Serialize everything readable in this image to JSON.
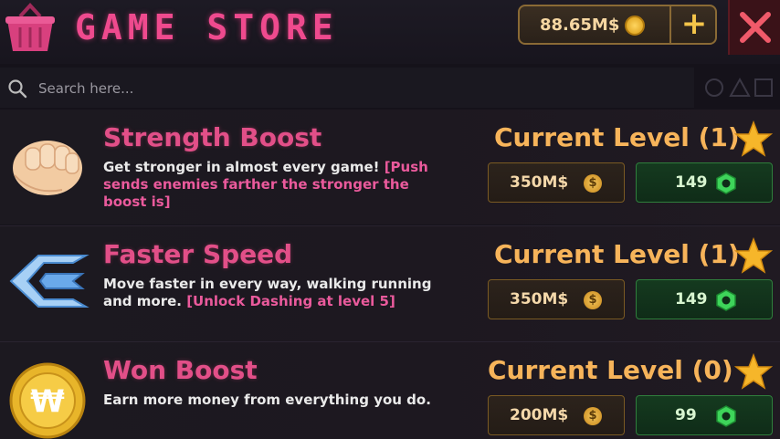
{
  "header": {
    "title": "GAME STORE",
    "currency_amount": "88.65M$",
    "icons": [
      "basket-icon",
      "coin-icon",
      "plus-icon",
      "close-icon"
    ]
  },
  "search": {
    "placeholder": "Search here...",
    "icons": [
      "search-icon",
      "circle-triangle-square-icon"
    ]
  },
  "items": [
    {
      "name": "Strength Boost",
      "desc_main": "Get stronger in almost every game! ",
      "desc_highlight": "[Push sends enemies farther the stronger the boost is]",
      "level_text": "Current Level (1)",
      "price": "350M$",
      "gems": "149",
      "icon": "fist-icon"
    },
    {
      "name": "Faster Speed",
      "desc_main": "Move faster in every way, walking running and more. ",
      "desc_highlight": "[Unlock Dashing at level 5]",
      "level_text": "Current Level (1)",
      "price": "350M$",
      "gems": "149",
      "icon": "speed-arrow-icon"
    },
    {
      "name": "Won Boost",
      "desc_main": "Earn more money from everything you do.",
      "desc_highlight": "",
      "level_text": "Current Level (0)",
      "price": "200M$",
      "gems": "99",
      "icon": "won-coin-icon"
    }
  ],
  "colors": {
    "title": "#ef4a8e",
    "item_name": "#e24f88",
    "level": "#f7b45a",
    "gem_button": "#153a1f",
    "price_button": "#2c231c"
  }
}
